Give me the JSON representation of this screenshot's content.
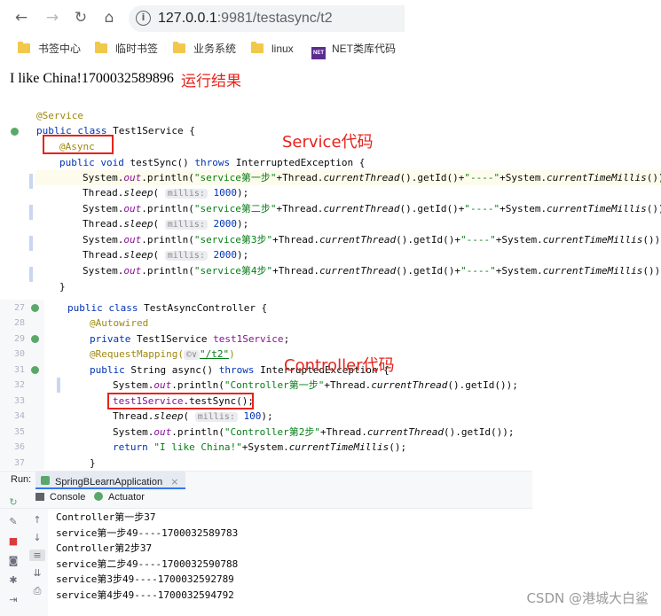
{
  "browser": {
    "url_host": "127.0.0.1",
    "url_rest": ":9981/testasync/t2",
    "bookmarks": [
      "书签中心",
      "临时书签",
      "业务系统",
      "linux",
      "NET类库代码"
    ]
  },
  "page": {
    "result_text": "I like China!1700032589896"
  },
  "annotations": {
    "result_label": "运行结果",
    "service_label": "Service代码",
    "controller_label": "Controller代码"
  },
  "service_code": {
    "l1": "@Service",
    "l2_kw": "public class",
    "l2_name": " Test1Service {",
    "l3": "@Async",
    "l4_kw1": "public void",
    "l4_mid": " testSync() ",
    "l4_kw2": "throws",
    "l4_end": " InterruptedException {",
    "p_sys": "System.",
    "p_out": "out",
    "p_println": ".println(",
    "s1": "\"service第一步\"",
    "s2": "\"service第二步\"",
    "s3": "\"service第3步\"",
    "s4": "\"service第4步\"",
    "p_mid": "+Thread.",
    "p_cur": "currentThread",
    "p_getid": "().getId()+",
    "p_dash": "\"----\"",
    "p_sys2": "+System.",
    "p_ctm": "currentTimeMillis",
    "p_end": "());",
    "sleep_pre": "Thread.",
    "sleep_name": "sleep",
    "sleep_open": "( ",
    "sleep_hint": "millis:",
    "sleep_v1": " 1000",
    "sleep_v2": " 2000",
    "sleep_close": ");",
    "close_brace": "}"
  },
  "controller_code": {
    "line_numbers": [
      "27",
      "28",
      "29",
      "30",
      "31",
      "32",
      "33",
      "34",
      "35",
      "36",
      "37"
    ],
    "l27_kw": "public class",
    "l27_name": " TestAsyncController {",
    "l28": "@Autowired",
    "l29_kw": "private",
    "l29_type": " Test1Service ",
    "l29_field": "test1Service",
    "l29_end": ";",
    "l30_ann": "@RequestMapping(",
    "l30_hint": "©∨",
    "l30_str": "\"/t2\"",
    "l30_end": ")",
    "l31_kw": "public",
    "l31_mid": " String async() ",
    "l31_kw2": "throws",
    "l31_end": " InterruptedException {",
    "l32_s": "\"Controller第一步\"",
    "l32_end": "+Thread.",
    "l32_cur": "currentThread",
    "l32_tail": "().getId());",
    "l33_field": "test1Service",
    "l33_end": ".testSync();",
    "l34_pre": "Thread.",
    "l34_name": "sleep",
    "l34_open": "( ",
    "l34_hint": "millis:",
    "l34_val": " 100",
    "l34_close": ");",
    "l35_s": "\"Controller第2步\"",
    "l36_kw": "return",
    "l36_s": " \"I like China!\"",
    "l36_end": "+System.",
    "l36_ctm": "currentTimeMillis",
    "l36_tail": "();",
    "l37": "}"
  },
  "run_panel": {
    "run_label": "Run:",
    "app_tab": "SpringBLearnApplication",
    "tab_close": "×",
    "console_tab": "Console",
    "actuator_tab": "Actuator",
    "output": [
      "Controller第一步37",
      "service第一步49----1700032589783",
      "Controller第2步37",
      "service第二步49----1700032590788",
      "service第3步49----1700032592789",
      "service第4步49----1700032594792"
    ]
  },
  "watermark": "CSDN @港城大白鲨",
  "colors": {
    "red_annotation": "#e8221b",
    "keyword": "#0033b3",
    "annotation": "#9e880d",
    "string": "#067d17",
    "field": "#871094"
  }
}
